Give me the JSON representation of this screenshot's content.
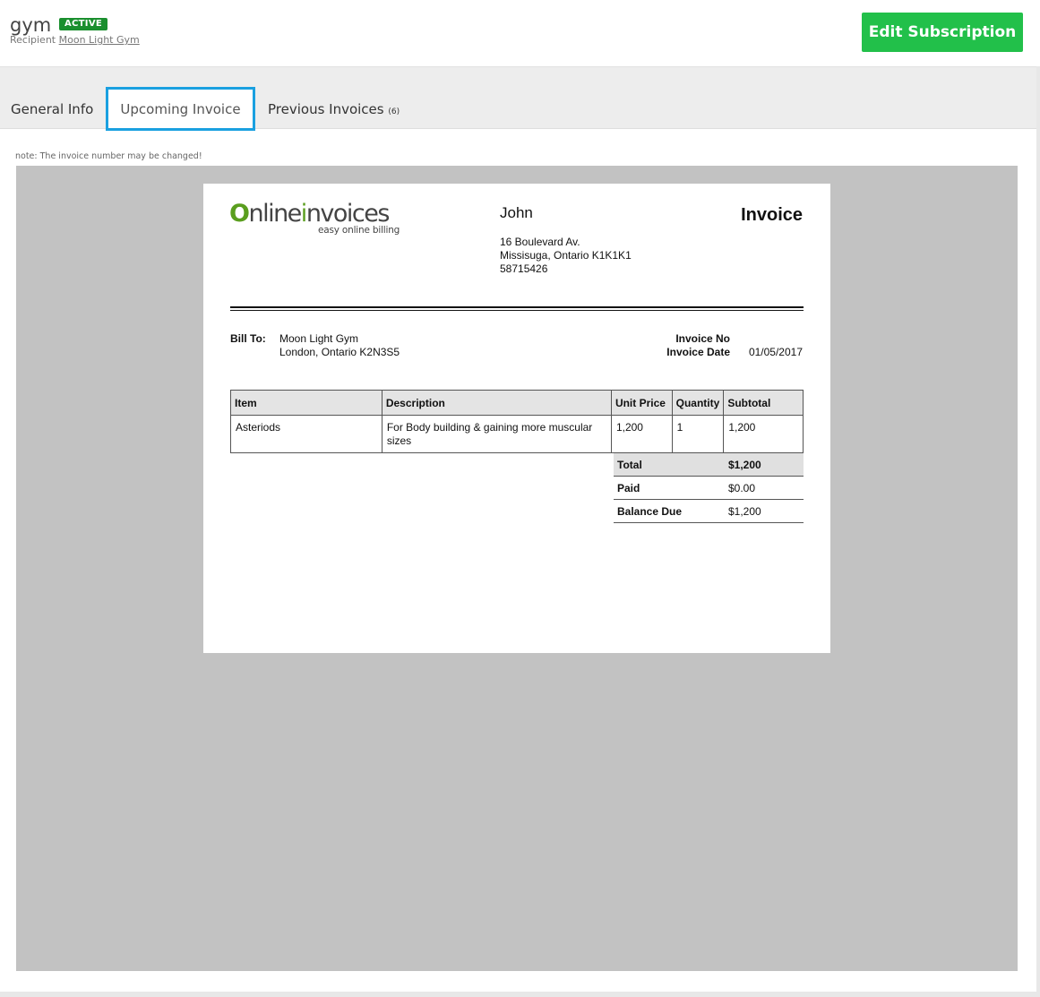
{
  "header": {
    "title": "gym",
    "status": "ACTIVE",
    "recipient_label": "Recipient",
    "recipient_name": "Moon Light Gym",
    "edit_button": "Edit Subscription"
  },
  "tabs": {
    "general": "General Info",
    "upcoming": "Upcoming Invoice",
    "previous": "Previous Invoices",
    "previous_count": "(6)",
    "selected": "Upcoming Invoice"
  },
  "note": "note: The invoice number may be changed!",
  "invoice": {
    "logo": {
      "online": "Online",
      "invoices": "invoices",
      "tagline": "easy online billing"
    },
    "from": {
      "name": "John",
      "address1": "16 Boulevard Av.",
      "address2": "Missisuga, Ontario K1K1K1",
      "phone": "58715426"
    },
    "title": "Invoice",
    "bill_to_label": "Bill To:",
    "bill_to_name": "Moon Light Gym",
    "bill_to_address": "London, Ontario K2N3S5",
    "invoice_no_label": "Invoice No",
    "invoice_no": "",
    "invoice_date_label": "Invoice Date",
    "invoice_date": "01/05/2017",
    "columns": {
      "item": "Item",
      "description": "Description",
      "unit_price": "Unit Price",
      "quantity": "Quantity",
      "subtotal": "Subtotal"
    },
    "rows": [
      {
        "item": "Asteriods",
        "description": "For Body building & gaining more muscular sizes",
        "unit_price": "1,200",
        "quantity": "1",
        "subtotal": "1,200"
      }
    ],
    "totals": {
      "total_label": "Total",
      "total": "$1,200",
      "paid_label": "Paid",
      "paid": "$0.00",
      "balance_label": "Balance Due",
      "balance": "$1,200"
    }
  },
  "colors": {
    "accent": "#22c04a",
    "badge": "#1a8f2e",
    "tab_highlight": "#1aa0e0",
    "viewer_bg": "#c2c2c2"
  }
}
